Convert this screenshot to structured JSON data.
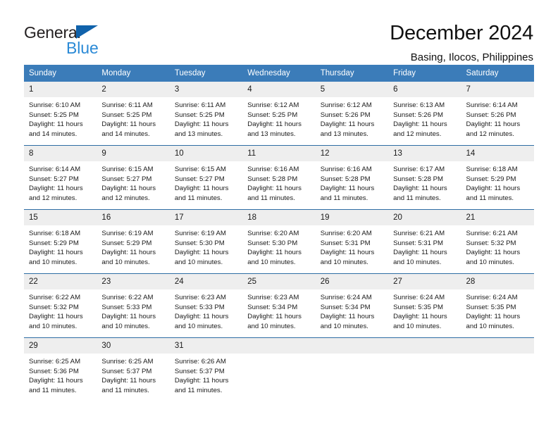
{
  "brand": {
    "name_part1": "General",
    "name_part2": "Blue",
    "triangle_color": "#1062ab",
    "blue_text_color": "#2b8ad6"
  },
  "header": {
    "title": "December 2024",
    "subtitle": "Basing, Ilocos, Philippines"
  },
  "theme": {
    "header_blue": "#3b7cb9",
    "rule_blue": "#2e6da4",
    "daynum_gray": "#eeeeee"
  },
  "weekdays": [
    "Sunday",
    "Monday",
    "Tuesday",
    "Wednesday",
    "Thursday",
    "Friday",
    "Saturday"
  ],
  "weeks": [
    [
      {
        "day": "1",
        "sunrise": "Sunrise: 6:10 AM",
        "sunset": "Sunset: 5:25 PM",
        "daylight1": "Daylight: 11 hours",
        "daylight2": "and 14 minutes."
      },
      {
        "day": "2",
        "sunrise": "Sunrise: 6:11 AM",
        "sunset": "Sunset: 5:25 PM",
        "daylight1": "Daylight: 11 hours",
        "daylight2": "and 14 minutes."
      },
      {
        "day": "3",
        "sunrise": "Sunrise: 6:11 AM",
        "sunset": "Sunset: 5:25 PM",
        "daylight1": "Daylight: 11 hours",
        "daylight2": "and 13 minutes."
      },
      {
        "day": "4",
        "sunrise": "Sunrise: 6:12 AM",
        "sunset": "Sunset: 5:25 PM",
        "daylight1": "Daylight: 11 hours",
        "daylight2": "and 13 minutes."
      },
      {
        "day": "5",
        "sunrise": "Sunrise: 6:12 AM",
        "sunset": "Sunset: 5:26 PM",
        "daylight1": "Daylight: 11 hours",
        "daylight2": "and 13 minutes."
      },
      {
        "day": "6",
        "sunrise": "Sunrise: 6:13 AM",
        "sunset": "Sunset: 5:26 PM",
        "daylight1": "Daylight: 11 hours",
        "daylight2": "and 12 minutes."
      },
      {
        "day": "7",
        "sunrise": "Sunrise: 6:14 AM",
        "sunset": "Sunset: 5:26 PM",
        "daylight1": "Daylight: 11 hours",
        "daylight2": "and 12 minutes."
      }
    ],
    [
      {
        "day": "8",
        "sunrise": "Sunrise: 6:14 AM",
        "sunset": "Sunset: 5:27 PM",
        "daylight1": "Daylight: 11 hours",
        "daylight2": "and 12 minutes."
      },
      {
        "day": "9",
        "sunrise": "Sunrise: 6:15 AM",
        "sunset": "Sunset: 5:27 PM",
        "daylight1": "Daylight: 11 hours",
        "daylight2": "and 12 minutes."
      },
      {
        "day": "10",
        "sunrise": "Sunrise: 6:15 AM",
        "sunset": "Sunset: 5:27 PM",
        "daylight1": "Daylight: 11 hours",
        "daylight2": "and 11 minutes."
      },
      {
        "day": "11",
        "sunrise": "Sunrise: 6:16 AM",
        "sunset": "Sunset: 5:28 PM",
        "daylight1": "Daylight: 11 hours",
        "daylight2": "and 11 minutes."
      },
      {
        "day": "12",
        "sunrise": "Sunrise: 6:16 AM",
        "sunset": "Sunset: 5:28 PM",
        "daylight1": "Daylight: 11 hours",
        "daylight2": "and 11 minutes."
      },
      {
        "day": "13",
        "sunrise": "Sunrise: 6:17 AM",
        "sunset": "Sunset: 5:28 PM",
        "daylight1": "Daylight: 11 hours",
        "daylight2": "and 11 minutes."
      },
      {
        "day": "14",
        "sunrise": "Sunrise: 6:18 AM",
        "sunset": "Sunset: 5:29 PM",
        "daylight1": "Daylight: 11 hours",
        "daylight2": "and 11 minutes."
      }
    ],
    [
      {
        "day": "15",
        "sunrise": "Sunrise: 6:18 AM",
        "sunset": "Sunset: 5:29 PM",
        "daylight1": "Daylight: 11 hours",
        "daylight2": "and 10 minutes."
      },
      {
        "day": "16",
        "sunrise": "Sunrise: 6:19 AM",
        "sunset": "Sunset: 5:29 PM",
        "daylight1": "Daylight: 11 hours",
        "daylight2": "and 10 minutes."
      },
      {
        "day": "17",
        "sunrise": "Sunrise: 6:19 AM",
        "sunset": "Sunset: 5:30 PM",
        "daylight1": "Daylight: 11 hours",
        "daylight2": "and 10 minutes."
      },
      {
        "day": "18",
        "sunrise": "Sunrise: 6:20 AM",
        "sunset": "Sunset: 5:30 PM",
        "daylight1": "Daylight: 11 hours",
        "daylight2": "and 10 minutes."
      },
      {
        "day": "19",
        "sunrise": "Sunrise: 6:20 AM",
        "sunset": "Sunset: 5:31 PM",
        "daylight1": "Daylight: 11 hours",
        "daylight2": "and 10 minutes."
      },
      {
        "day": "20",
        "sunrise": "Sunrise: 6:21 AM",
        "sunset": "Sunset: 5:31 PM",
        "daylight1": "Daylight: 11 hours",
        "daylight2": "and 10 minutes."
      },
      {
        "day": "21",
        "sunrise": "Sunrise: 6:21 AM",
        "sunset": "Sunset: 5:32 PM",
        "daylight1": "Daylight: 11 hours",
        "daylight2": "and 10 minutes."
      }
    ],
    [
      {
        "day": "22",
        "sunrise": "Sunrise: 6:22 AM",
        "sunset": "Sunset: 5:32 PM",
        "daylight1": "Daylight: 11 hours",
        "daylight2": "and 10 minutes."
      },
      {
        "day": "23",
        "sunrise": "Sunrise: 6:22 AM",
        "sunset": "Sunset: 5:33 PM",
        "daylight1": "Daylight: 11 hours",
        "daylight2": "and 10 minutes."
      },
      {
        "day": "24",
        "sunrise": "Sunrise: 6:23 AM",
        "sunset": "Sunset: 5:33 PM",
        "daylight1": "Daylight: 11 hours",
        "daylight2": "and 10 minutes."
      },
      {
        "day": "25",
        "sunrise": "Sunrise: 6:23 AM",
        "sunset": "Sunset: 5:34 PM",
        "daylight1": "Daylight: 11 hours",
        "daylight2": "and 10 minutes."
      },
      {
        "day": "26",
        "sunrise": "Sunrise: 6:24 AM",
        "sunset": "Sunset: 5:34 PM",
        "daylight1": "Daylight: 11 hours",
        "daylight2": "and 10 minutes."
      },
      {
        "day": "27",
        "sunrise": "Sunrise: 6:24 AM",
        "sunset": "Sunset: 5:35 PM",
        "daylight1": "Daylight: 11 hours",
        "daylight2": "and 10 minutes."
      },
      {
        "day": "28",
        "sunrise": "Sunrise: 6:24 AM",
        "sunset": "Sunset: 5:35 PM",
        "daylight1": "Daylight: 11 hours",
        "daylight2": "and 10 minutes."
      }
    ],
    [
      {
        "day": "29",
        "sunrise": "Sunrise: 6:25 AM",
        "sunset": "Sunset: 5:36 PM",
        "daylight1": "Daylight: 11 hours",
        "daylight2": "and 11 minutes."
      },
      {
        "day": "30",
        "sunrise": "Sunrise: 6:25 AM",
        "sunset": "Sunset: 5:37 PM",
        "daylight1": "Daylight: 11 hours",
        "daylight2": "and 11 minutes."
      },
      {
        "day": "31",
        "sunrise": "Sunrise: 6:26 AM",
        "sunset": "Sunset: 5:37 PM",
        "daylight1": "Daylight: 11 hours",
        "daylight2": "and 11 minutes."
      },
      {
        "day": "",
        "sunrise": "",
        "sunset": "",
        "daylight1": "",
        "daylight2": ""
      },
      {
        "day": "",
        "sunrise": "",
        "sunset": "",
        "daylight1": "",
        "daylight2": ""
      },
      {
        "day": "",
        "sunrise": "",
        "sunset": "",
        "daylight1": "",
        "daylight2": ""
      },
      {
        "day": "",
        "sunrise": "",
        "sunset": "",
        "daylight1": "",
        "daylight2": ""
      }
    ]
  ]
}
